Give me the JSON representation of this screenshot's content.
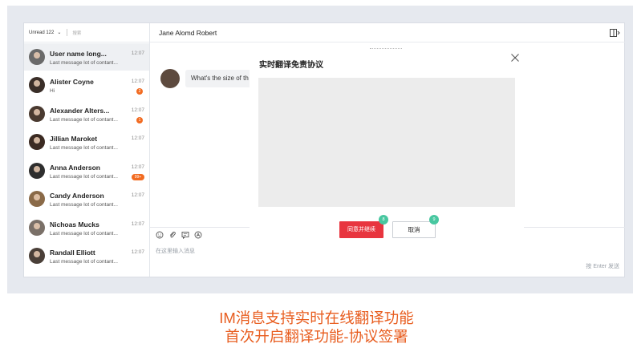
{
  "sidebar": {
    "filter_label": "Unread 122",
    "search_placeholder": "搜索",
    "conversations": [
      {
        "name": "User name long...",
        "preview": "Last message lot of contant...",
        "time": "12:07",
        "badge": "",
        "active": true
      },
      {
        "name": "Alister Coyne",
        "preview": "Hi",
        "time": "12:07",
        "badge": "2"
      },
      {
        "name": "Alexander Alters...",
        "preview": "Last message lot of contant...",
        "time": "12:07",
        "badge": "1"
      },
      {
        "name": "Jillian Maroket",
        "preview": "Last message lot of contant...",
        "time": "12:07",
        "badge": ""
      },
      {
        "name": "Anna Anderson",
        "preview": "Last message lot of contant...",
        "time": "12:07",
        "badge": "99+"
      },
      {
        "name": "Candy Anderson",
        "preview": "Last message lot of contant...",
        "time": "12:07",
        "badge": ""
      },
      {
        "name": "Nichoas Mucks",
        "preview": "Last message lot of contant...",
        "time": "12:07",
        "badge": ""
      },
      {
        "name": "Randall Elliott",
        "preview": "Last message lot of contant...",
        "time": "12:07",
        "badge": ""
      }
    ]
  },
  "chat": {
    "title": "Jane Alomd Robert",
    "message": "What's the size of th",
    "input_placeholder": "在这里输入消息",
    "send_hint": "按 Enter 发送"
  },
  "modal": {
    "title": "实时翻译免责协议",
    "agree_label": "同意并继续",
    "cancel_label": "取消",
    "agree_marker": "8",
    "cancel_marker": "9"
  },
  "caption": {
    "line1": "IM消息支持实时在线翻译功能",
    "line2": "首次开启翻译功能-协议签署"
  },
  "colors": {
    "accent": "#e8353f",
    "badge": "#f26b21",
    "marker": "#48c7a0",
    "caption": "#e85d1f"
  }
}
